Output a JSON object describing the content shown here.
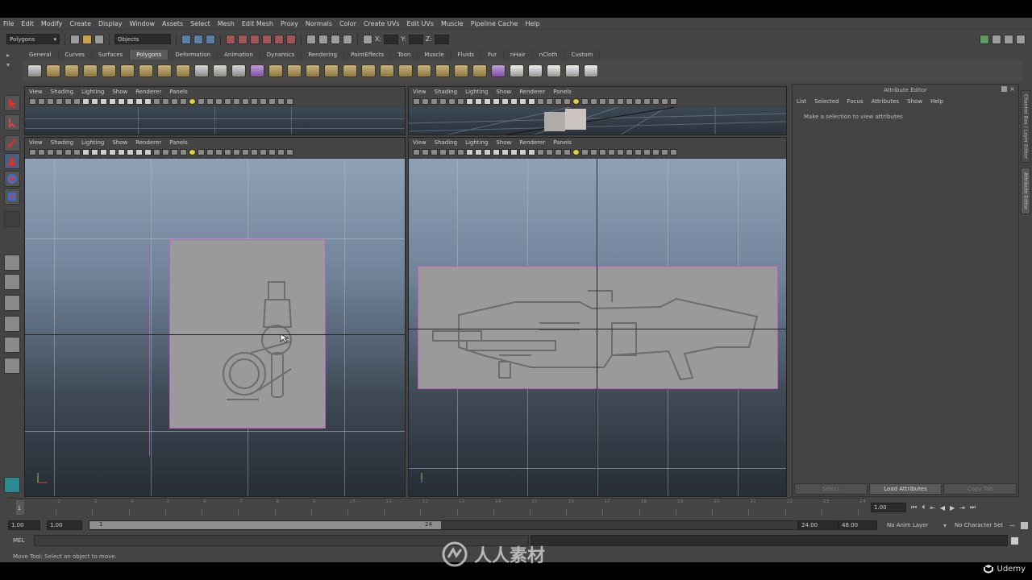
{
  "menubar": [
    "File",
    "Edit",
    "Modify",
    "Create",
    "Display",
    "Window",
    "Assets",
    "Select",
    "Mesh",
    "Edit Mesh",
    "Proxy",
    "Normals",
    "Color",
    "Create UVs",
    "Edit UVs",
    "Muscle",
    "Pipeline Cache",
    "Help"
  ],
  "status": {
    "mode": "Polygons",
    "selection_mode": "Objects",
    "x_label": "X:",
    "y_label": "Y:",
    "z_label": "Z:"
  },
  "shelf_tabs": [
    "General",
    "Curves",
    "Surfaces",
    "Polygons",
    "Deformation",
    "Animation",
    "Dynamics",
    "Rendering",
    "PaintEffects",
    "Toon",
    "Muscle",
    "Fluids",
    "Fur",
    "nHair",
    "nCloth",
    "Custom"
  ],
  "active_shelf": "Polygons",
  "viewport_menu": [
    "View",
    "Shading",
    "Lighting",
    "Show",
    "Renderer",
    "Panels"
  ],
  "attribute_editor": {
    "title": "Attribute Editor",
    "menu": [
      "List",
      "Selected",
      "Focus",
      "Attributes",
      "Show",
      "Help"
    ],
    "message": "Make a selection to view attributes",
    "buttons": [
      "Select",
      "Load Attributes",
      "Copy Tab"
    ]
  },
  "side_tabs": [
    "Channel Box / Layer Editor",
    "Attribute Editor"
  ],
  "timeline": {
    "ticks": [
      "1",
      "2",
      "3",
      "4",
      "5",
      "6",
      "7",
      "8",
      "9",
      "10",
      "11",
      "12",
      "13",
      "14",
      "15",
      "16",
      "17",
      "18",
      "19",
      "20",
      "21",
      "22",
      "23",
      "24"
    ],
    "current_frame": "1.00"
  },
  "range": {
    "start": "1.00",
    "playback_start": "1.00",
    "slider_start": "1",
    "slider_end": "24",
    "playback_end": "24.00",
    "end": "48.00",
    "anim_layer": "No Anim Layer",
    "char_set": "No Character Set"
  },
  "cmd": {
    "label": "MEL"
  },
  "help_line": "Move Tool: Select an object to move.",
  "watermark": "人人素材",
  "brand": "Udemy",
  "colors": {
    "select_highlight": "#c45bc4",
    "viewport_top": "#8ea1b7",
    "viewport_bottom": "#262d35"
  }
}
